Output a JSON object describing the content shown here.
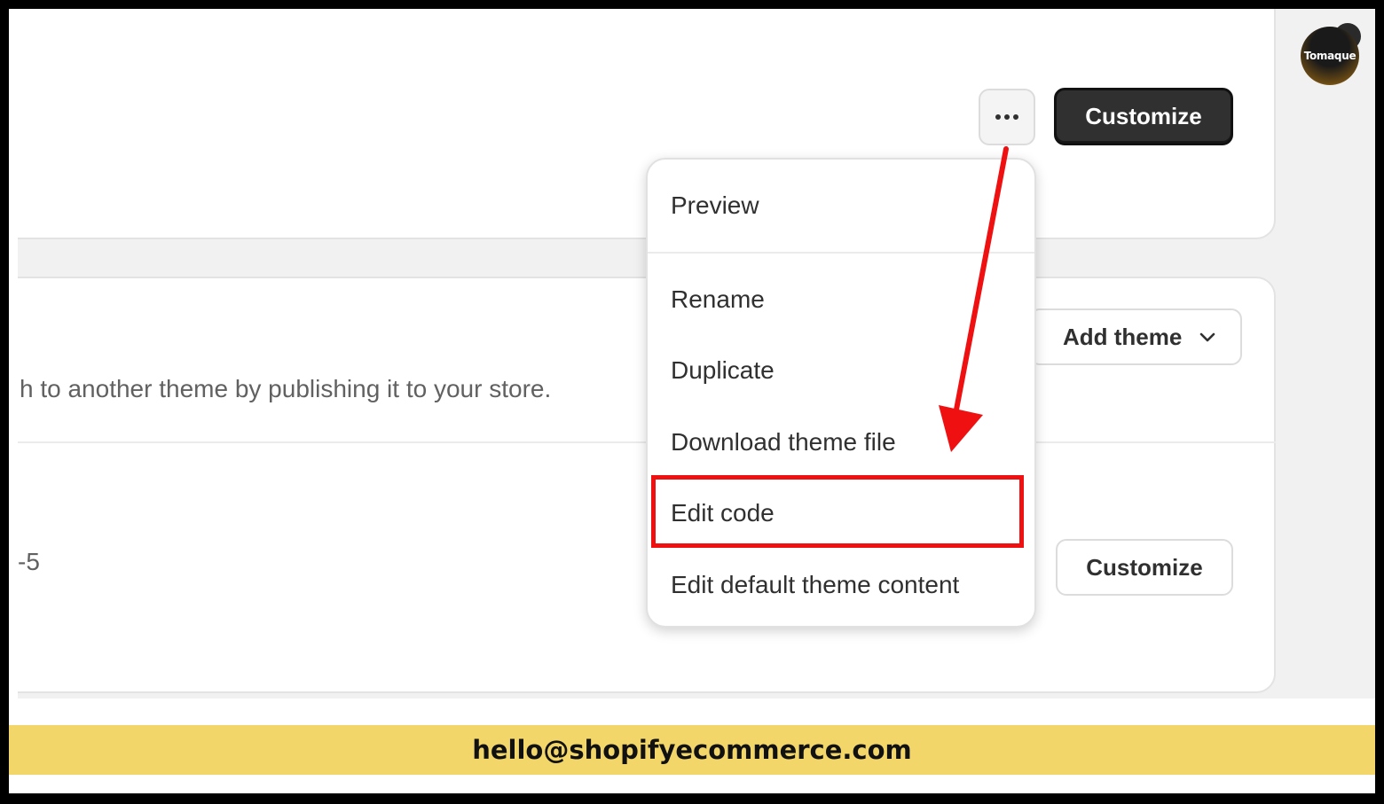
{
  "theme_page": {
    "more_actions_label": "•••",
    "customize_primary_label": "Customize",
    "add_theme_label": "Add theme",
    "library_description": "h to another theme by publishing it to your store.",
    "theme_version_fragment": "-5",
    "customize_secondary_label": "Customize"
  },
  "more_menu": {
    "items": [
      {
        "label": "Preview"
      },
      {
        "label": "Rename"
      },
      {
        "label": "Duplicate"
      },
      {
        "label": "Download theme file"
      },
      {
        "label": "Edit code"
      },
      {
        "label": "Edit default theme content"
      }
    ],
    "highlighted_item": "Edit code"
  },
  "annotation": {
    "arrow_color": "#ef1111",
    "highlight_color": "#ef1111"
  },
  "footer": {
    "email": "hello@shopifyecommerce.com",
    "background_color": "#f2d66a"
  },
  "logo": {
    "text": "Tomaque"
  },
  "colors": {
    "primary_button": "#303030",
    "page_background": "#f1f1f1",
    "card_background": "#ffffff"
  }
}
